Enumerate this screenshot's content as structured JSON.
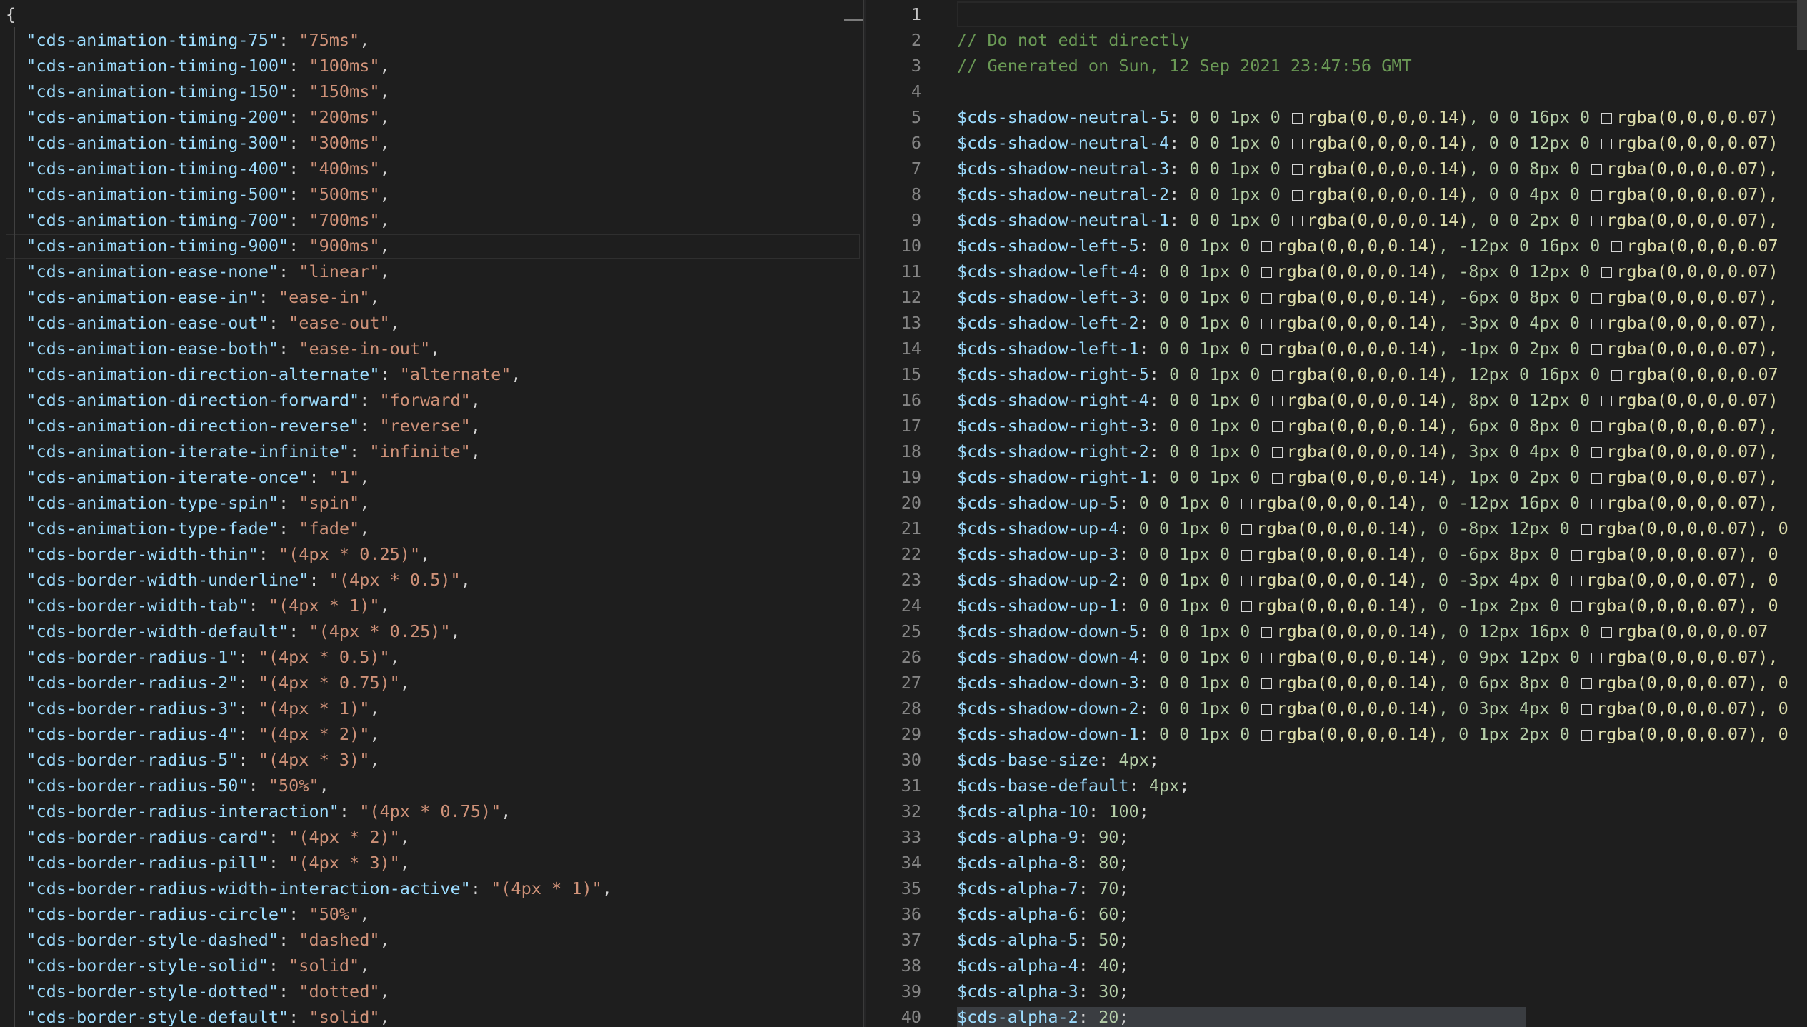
{
  "left": {
    "open_brace": "{",
    "entries": [
      {
        "key": "cds-animation-timing-75",
        "value": "75ms"
      },
      {
        "key": "cds-animation-timing-100",
        "value": "100ms"
      },
      {
        "key": "cds-animation-timing-150",
        "value": "150ms"
      },
      {
        "key": "cds-animation-timing-200",
        "value": "200ms"
      },
      {
        "key": "cds-animation-timing-300",
        "value": "300ms"
      },
      {
        "key": "cds-animation-timing-400",
        "value": "400ms"
      },
      {
        "key": "cds-animation-timing-500",
        "value": "500ms"
      },
      {
        "key": "cds-animation-timing-700",
        "value": "700ms"
      },
      {
        "key": "cds-animation-timing-900",
        "value": "900ms"
      },
      {
        "key": "cds-animation-ease-none",
        "value": "linear"
      },
      {
        "key": "cds-animation-ease-in",
        "value": "ease-in"
      },
      {
        "key": "cds-animation-ease-out",
        "value": "ease-out"
      },
      {
        "key": "cds-animation-ease-both",
        "value": "ease-in-out"
      },
      {
        "key": "cds-animation-direction-alternate",
        "value": "alternate"
      },
      {
        "key": "cds-animation-direction-forward",
        "value": "forward"
      },
      {
        "key": "cds-animation-direction-reverse",
        "value": "reverse"
      },
      {
        "key": "cds-animation-iterate-infinite",
        "value": "infinite"
      },
      {
        "key": "cds-animation-iterate-once",
        "value": "1"
      },
      {
        "key": "cds-animation-type-spin",
        "value": "spin"
      },
      {
        "key": "cds-animation-type-fade",
        "value": "fade"
      },
      {
        "key": "cds-border-width-thin",
        "value": "(4px * 0.25)"
      },
      {
        "key": "cds-border-width-underline",
        "value": "(4px * 0.5)"
      },
      {
        "key": "cds-border-width-tab",
        "value": "(4px * 1)"
      },
      {
        "key": "cds-border-width-default",
        "value": "(4px * 0.25)"
      },
      {
        "key": "cds-border-radius-1",
        "value": "(4px * 0.5)"
      },
      {
        "key": "cds-border-radius-2",
        "value": "(4px * 0.75)"
      },
      {
        "key": "cds-border-radius-3",
        "value": "(4px * 1)"
      },
      {
        "key": "cds-border-radius-4",
        "value": "(4px * 2)"
      },
      {
        "key": "cds-border-radius-5",
        "value": "(4px * 3)"
      },
      {
        "key": "cds-border-radius-50",
        "value": "50%"
      },
      {
        "key": "cds-border-radius-interaction",
        "value": "(4px * 0.75)"
      },
      {
        "key": "cds-border-radius-card",
        "value": "(4px * 2)"
      },
      {
        "key": "cds-border-radius-pill",
        "value": "(4px * 3)"
      },
      {
        "key": "cds-border-radius-width-interaction-active",
        "value": "(4px * 1)"
      },
      {
        "key": "cds-border-radius-circle",
        "value": "50%"
      },
      {
        "key": "cds-border-style-dashed",
        "value": "dashed"
      },
      {
        "key": "cds-border-style-solid",
        "value": "solid"
      },
      {
        "key": "cds-border-style-dotted",
        "value": "dotted"
      },
      {
        "key": "cds-border-style-default",
        "value": "solid"
      }
    ]
  },
  "right": {
    "active_line": "1",
    "lines": [
      {
        "num": "1",
        "type": "blank"
      },
      {
        "num": "2",
        "type": "comment",
        "text": "// Do not edit directly"
      },
      {
        "num": "3",
        "type": "comment",
        "text": "// Generated on Sun, 12 Sep 2021 23:47:56 GMT"
      },
      {
        "num": "4",
        "type": "blank"
      },
      {
        "num": "5",
        "type": "shadow",
        "name": "$cds-shadow-neutral-5",
        "pre": "0 0 1px 0",
        "mid": ", 0 0 16px 0",
        "rgba1": "rgba(0,0,0,0.14)",
        "rgba2": "rgba(0,0,0,0.07)"
      },
      {
        "num": "6",
        "type": "shadow",
        "name": "$cds-shadow-neutral-4",
        "pre": "0 0 1px 0",
        "mid": ", 0 0 12px 0",
        "rgba1": "rgba(0,0,0,0.14)",
        "rgba2": "rgba(0,0,0,0.07)"
      },
      {
        "num": "7",
        "type": "shadow",
        "name": "$cds-shadow-neutral-3",
        "pre": "0 0 1px 0",
        "mid": ", 0 0 8px 0",
        "rgba1": "rgba(0,0,0,0.14)",
        "rgba2": "rgba(0,0,0,0.07),"
      },
      {
        "num": "8",
        "type": "shadow",
        "name": "$cds-shadow-neutral-2",
        "pre": "0 0 1px 0",
        "mid": ", 0 0 4px 0",
        "rgba1": "rgba(0,0,0,0.14)",
        "rgba2": "rgba(0,0,0,0.07),"
      },
      {
        "num": "9",
        "type": "shadow",
        "name": "$cds-shadow-neutral-1",
        "pre": "0 0 1px 0",
        "mid": ", 0 0 2px 0",
        "rgba1": "rgba(0,0,0,0.14)",
        "rgba2": "rgba(0,0,0,0.07),"
      },
      {
        "num": "10",
        "type": "shadow",
        "name": "$cds-shadow-left-5",
        "pre": "0 0 1px 0",
        "mid": ", -12px 0 16px 0",
        "rgba1": "rgba(0,0,0,0.14)",
        "rgba2": "rgba(0,0,0,0.07"
      },
      {
        "num": "11",
        "type": "shadow",
        "name": "$cds-shadow-left-4",
        "pre": "0 0 1px 0",
        "mid": ", -8px 0 12px 0",
        "rgba1": "rgba(0,0,0,0.14)",
        "rgba2": "rgba(0,0,0,0.07)"
      },
      {
        "num": "12",
        "type": "shadow",
        "name": "$cds-shadow-left-3",
        "pre": "0 0 1px 0",
        "mid": ", -6px 0 8px 0",
        "rgba1": "rgba(0,0,0,0.14)",
        "rgba2": "rgba(0,0,0,0.07),"
      },
      {
        "num": "13",
        "type": "shadow",
        "name": "$cds-shadow-left-2",
        "pre": "0 0 1px 0",
        "mid": ", -3px 0 4px 0",
        "rgba1": "rgba(0,0,0,0.14)",
        "rgba2": "rgba(0,0,0,0.07),"
      },
      {
        "num": "14",
        "type": "shadow",
        "name": "$cds-shadow-left-1",
        "pre": "0 0 1px 0",
        "mid": ", -1px 0 2px 0",
        "rgba1": "rgba(0,0,0,0.14)",
        "rgba2": "rgba(0,0,0,0.07),"
      },
      {
        "num": "15",
        "type": "shadow",
        "name": "$cds-shadow-right-5",
        "pre": "0 0 1px 0",
        "mid": ", 12px 0 16px 0",
        "rgba1": "rgba(0,0,0,0.14)",
        "rgba2": "rgba(0,0,0,0.07"
      },
      {
        "num": "16",
        "type": "shadow",
        "name": "$cds-shadow-right-4",
        "pre": "0 0 1px 0",
        "mid": ", 8px 0 12px 0",
        "rgba1": "rgba(0,0,0,0.14)",
        "rgba2": "rgba(0,0,0,0.07)"
      },
      {
        "num": "17",
        "type": "shadow",
        "name": "$cds-shadow-right-3",
        "pre": "0 0 1px 0",
        "mid": ", 6px 0 8px 0",
        "rgba1": "rgba(0,0,0,0.14)",
        "rgba2": "rgba(0,0,0,0.07),"
      },
      {
        "num": "18",
        "type": "shadow",
        "name": "$cds-shadow-right-2",
        "pre": "0 0 1px 0",
        "mid": ", 3px 0 4px 0",
        "rgba1": "rgba(0,0,0,0.14)",
        "rgba2": "rgba(0,0,0,0.07),"
      },
      {
        "num": "19",
        "type": "shadow",
        "name": "$cds-shadow-right-1",
        "pre": "0 0 1px 0",
        "mid": ", 1px 0 2px 0",
        "rgba1": "rgba(0,0,0,0.14)",
        "rgba2": "rgba(0,0,0,0.07),"
      },
      {
        "num": "20",
        "type": "shadow",
        "name": "$cds-shadow-up-5",
        "pre": "0 0 1px 0",
        "mid": ", 0 -12px 16px 0",
        "rgba1": "rgba(0,0,0,0.14)",
        "rgba2": "rgba(0,0,0,0.07),"
      },
      {
        "num": "21",
        "type": "shadow",
        "name": "$cds-shadow-up-4",
        "pre": "0 0 1px 0",
        "mid": ", 0 -8px 12px 0",
        "rgba1": "rgba(0,0,0,0.14)",
        "rgba2": "rgba(0,0,0,0.07), 0"
      },
      {
        "num": "22",
        "type": "shadow",
        "name": "$cds-shadow-up-3",
        "pre": "0 0 1px 0",
        "mid": ", 0 -6px 8px 0",
        "rgba1": "rgba(0,0,0,0.14)",
        "rgba2": "rgba(0,0,0,0.07), 0"
      },
      {
        "num": "23",
        "type": "shadow",
        "name": "$cds-shadow-up-2",
        "pre": "0 0 1px 0",
        "mid": ", 0 -3px 4px 0",
        "rgba1": "rgba(0,0,0,0.14)",
        "rgba2": "rgba(0,0,0,0.07), 0"
      },
      {
        "num": "24",
        "type": "shadow",
        "name": "$cds-shadow-up-1",
        "pre": "0 0 1px 0",
        "mid": ", 0 -1px 2px 0",
        "rgba1": "rgba(0,0,0,0.14)",
        "rgba2": "rgba(0,0,0,0.07), 0"
      },
      {
        "num": "25",
        "type": "shadow",
        "name": "$cds-shadow-down-5",
        "pre": "0 0 1px 0",
        "mid": ", 0 12px 16px 0",
        "rgba1": "rgba(0,0,0,0.14)",
        "rgba2": "rgba(0,0,0,0.07"
      },
      {
        "num": "26",
        "type": "shadow",
        "name": "$cds-shadow-down-4",
        "pre": "0 0 1px 0",
        "mid": ", 0 9px 12px 0",
        "rgba1": "rgba(0,0,0,0.14)",
        "rgba2": "rgba(0,0,0,0.07),"
      },
      {
        "num": "27",
        "type": "shadow",
        "name": "$cds-shadow-down-3",
        "pre": "0 0 1px 0",
        "mid": ", 0 6px 8px 0",
        "rgba1": "rgba(0,0,0,0.14)",
        "rgba2": "rgba(0,0,0,0.07), 0"
      },
      {
        "num": "28",
        "type": "shadow",
        "name": "$cds-shadow-down-2",
        "pre": "0 0 1px 0",
        "mid": ", 0 3px 4px 0",
        "rgba1": "rgba(0,0,0,0.14)",
        "rgba2": "rgba(0,0,0,0.07), 0"
      },
      {
        "num": "29",
        "type": "shadow",
        "name": "$cds-shadow-down-1",
        "pre": "0 0 1px 0",
        "mid": ", 0 1px 2px 0",
        "rgba1": "rgba(0,0,0,0.14)",
        "rgba2": "rgba(0,0,0,0.07), 0"
      },
      {
        "num": "30",
        "type": "var",
        "name": "$cds-base-size",
        "value": "4px"
      },
      {
        "num": "31",
        "type": "var",
        "name": "$cds-base-default",
        "value": "4px"
      },
      {
        "num": "32",
        "type": "var",
        "name": "$cds-alpha-10",
        "value": "100"
      },
      {
        "num": "33",
        "type": "var",
        "name": "$cds-alpha-9",
        "value": "90"
      },
      {
        "num": "34",
        "type": "var",
        "name": "$cds-alpha-8",
        "value": "80"
      },
      {
        "num": "35",
        "type": "var",
        "name": "$cds-alpha-7",
        "value": "70"
      },
      {
        "num": "36",
        "type": "var",
        "name": "$cds-alpha-6",
        "value": "60"
      },
      {
        "num": "37",
        "type": "var",
        "name": "$cds-alpha-5",
        "value": "50"
      },
      {
        "num": "38",
        "type": "var",
        "name": "$cds-alpha-4",
        "value": "40"
      },
      {
        "num": "39",
        "type": "var",
        "name": "$cds-alpha-3",
        "value": "30"
      },
      {
        "num": "40",
        "type": "var",
        "name": "$cds-alpha-2",
        "value": "20"
      }
    ]
  },
  "theme": {
    "background": "#1e1e1e",
    "key_color": "#9cdcfe",
    "string_color": "#ce9178",
    "comment_color": "#6a9955",
    "number_color": "#b5cea8",
    "function_color": "#dcdcaa",
    "line_number_color": "#858585"
  }
}
